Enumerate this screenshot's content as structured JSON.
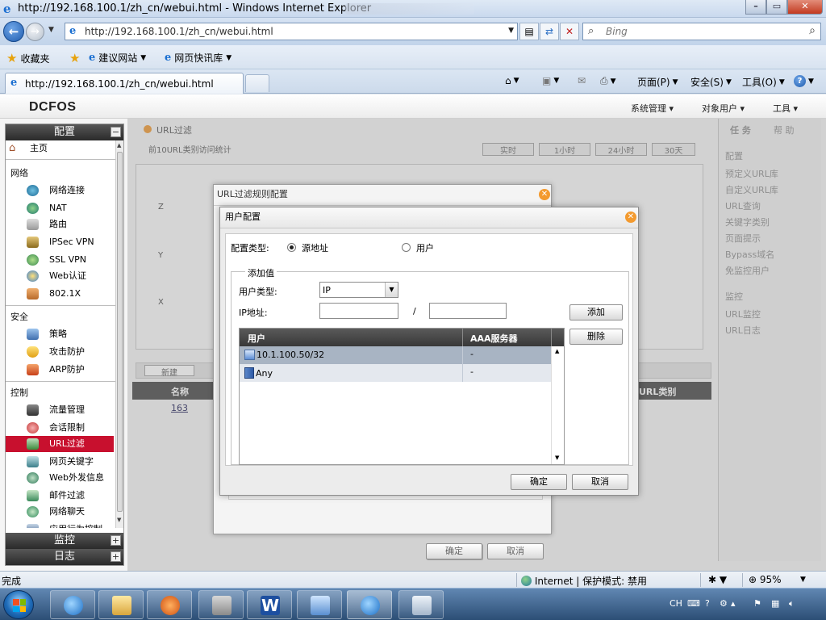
{
  "browser": {
    "title": "http://192.168.100.1/zh_cn/webui.html - Windows Internet Explorer",
    "url": "http://192.168.100.1/zh_cn/webui.html",
    "search_placeholder": "Bing",
    "favorites_label": "收藏夹",
    "fav_links": [
      "建议网站",
      "网页快讯库"
    ],
    "tab_label": "http://192.168.100.1/zh_cn/webui.html",
    "commands": [
      "页面(P)",
      "安全(S)",
      "工具(O)"
    ]
  },
  "app": {
    "brand": "DCFOS",
    "top_menu": [
      "系统管理",
      "对象用户",
      "工具"
    ],
    "sidebar": {
      "config_header": "配置",
      "home": "主页",
      "groups": [
        {
          "label": "网络",
          "items": [
            "网络连接",
            "NAT",
            "路由",
            "IPSec VPN",
            "SSL VPN",
            "Web认证",
            "802.1X"
          ]
        },
        {
          "label": "安全",
          "items": [
            "策略",
            "攻击防护",
            "ARP防护"
          ]
        },
        {
          "label": "控制",
          "items": [
            "流量管理",
            "会话限制",
            "URL过滤",
            "网页关键字",
            "Web外发信息",
            "邮件过滤",
            "网络聊天",
            "应用行为控制"
          ]
        }
      ],
      "selected": "URL过滤",
      "monitor_header": "监控",
      "log_header": "日志"
    },
    "background": {
      "section_title": "URL过滤",
      "subtitle": "前10URL类别访问统计",
      "time_tabs": [
        "实时",
        "1小时",
        "24小时",
        "30天"
      ],
      "axis_letters": [
        "Z",
        "Y",
        "X"
      ],
      "new_button": "新建",
      "col_name": "名称",
      "col_category": "URL类别",
      "row_name": "163",
      "task_tabs": [
        "任 务",
        "帮 助"
      ],
      "task_config": "配置",
      "task_config_items": [
        "预定义URL库",
        "自定义URL库",
        "URL查询",
        "关键字类别",
        "页面提示",
        "Bypass域名",
        "免监控用户"
      ],
      "task_monitor": "监控",
      "task_monitor_items": [
        "URL监控",
        "URL日志"
      ]
    },
    "dialog_outer": {
      "title": "URL过滤规则配置",
      "ok": "确定",
      "cancel": "取消"
    },
    "dialog": {
      "title": "用户配置",
      "config_type_label": "配置类型:",
      "radio_source": "源地址",
      "radio_user": "用户",
      "add_value_legend": "添加值",
      "user_type_label": "用户类型:",
      "user_type_value": "IP",
      "ip_label": "IP地址:",
      "slash": "/",
      "add_button": "添加",
      "delete_button": "删除",
      "col_user": "用户",
      "col_aaa": "AAA服务器",
      "rows": [
        {
          "user": "10.1.100.50/32",
          "aaa": "-"
        },
        {
          "user": "Any",
          "aaa": "-"
        }
      ],
      "ok_button": "确定",
      "cancel_button": "取消"
    }
  },
  "status": {
    "left": "完成",
    "zone": "Internet | 保护模式: 禁用",
    "zoom": "95%"
  },
  "tray": {
    "lang": "CH"
  }
}
